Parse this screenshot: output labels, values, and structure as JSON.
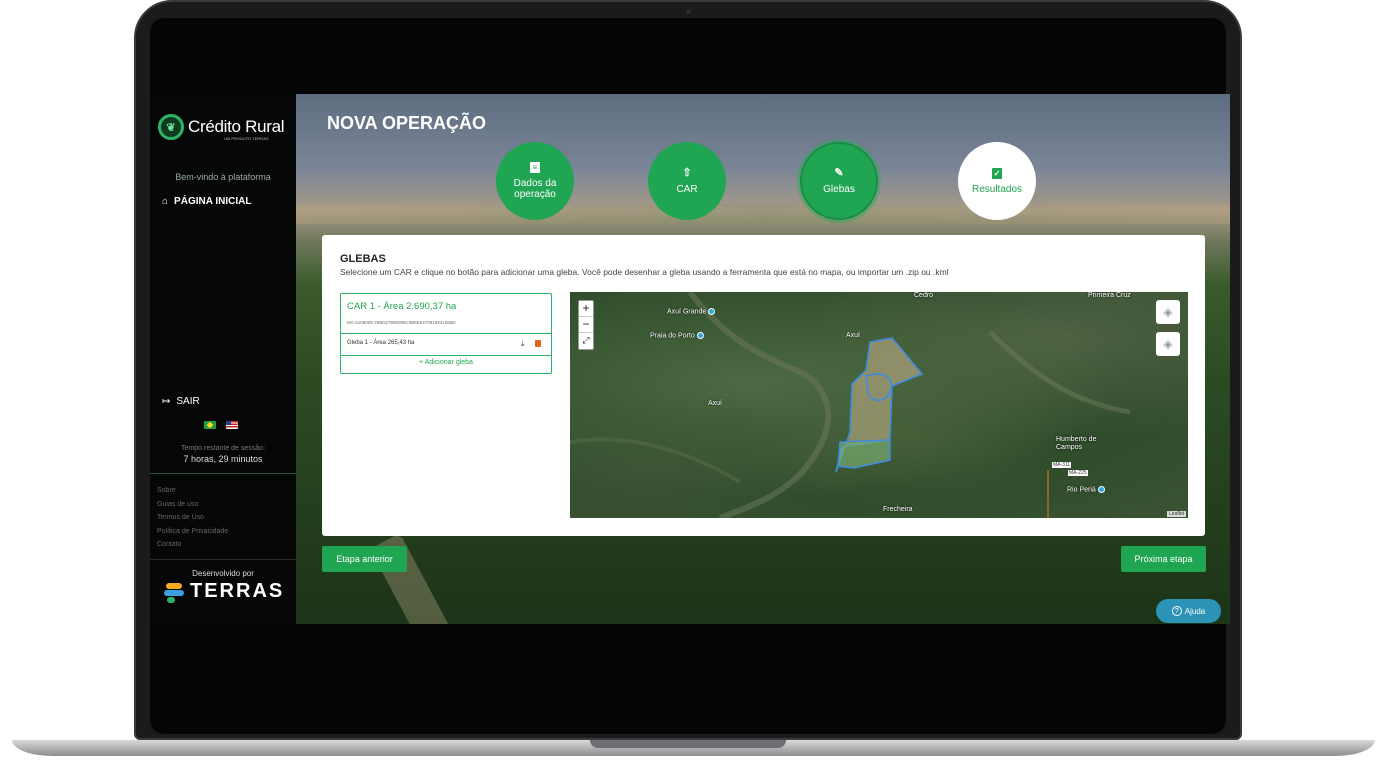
{
  "sidebar": {
    "logo_text": "Crédito Rural",
    "logo_sub": "UM PRODUTO TERRAS",
    "welcome": "Bem-vindo à plataforma",
    "nav_home": "PÁGINA INICIAL",
    "logout": "SAIR",
    "session_label": "Tempo restante de sessão:",
    "session_value": "7 horas, 29 minutos",
    "footer_links": [
      "Sobre",
      "Guias de uso",
      "Termos de Uso",
      "Política de Privacidade",
      "Contato"
    ],
    "developed_by": "Desenvolvido por",
    "brand": "TERRAS"
  },
  "main": {
    "title": "NOVA OPERAÇÃO",
    "steps": [
      {
        "label_line1": "Dados da",
        "label_line2": "operação",
        "icon": "clipboard-icon"
      },
      {
        "label_line1": "CAR",
        "label_line2": "",
        "icon": "upload-icon"
      },
      {
        "label_line1": "Glebas",
        "label_line2": "",
        "icon": "pencil-icon"
      },
      {
        "label_line1": "Resultados",
        "label_line2": "",
        "icon": "clipboard-check-icon"
      }
    ],
    "card": {
      "title": "GLEBAS",
      "description": "Selecione um CAR e clique no botão para adicionar uma gleba. Você pode desenhar a gleba usando a ferramenta que está no mapa, ou importar um .zip ou .kml",
      "car_title": "CAR 1 - Área 2.690,37 ha",
      "car_code": "MA-2105005-7B5D27685095C0B5E6470819541068D",
      "gleba_label": "Gleba 1 - Área 265,43 ha",
      "add_gleba": "+ Adicionar gleba"
    },
    "map": {
      "labels": [
        "Axuí Grande",
        "Praia do Porto",
        "Axuí",
        "Axuí",
        "Cedro",
        "Primeira Cruz",
        "Humberto de Campos",
        "Rio Periá",
        "Frecheira",
        "MA-311",
        "MA-225"
      ],
      "zoom_in": "+",
      "zoom_out": "−",
      "fullscreen": "⤢",
      "attribution": "Leaflet"
    },
    "btn_prev": "Etapa anterior",
    "btn_next": "Próxima etapa",
    "help": "Ajuda",
    "help_icon_glyph": "?"
  },
  "colors": {
    "primary_green": "#20a552",
    "help_blue": "#2b93b5",
    "gleba_outline": "#3d8be0"
  }
}
